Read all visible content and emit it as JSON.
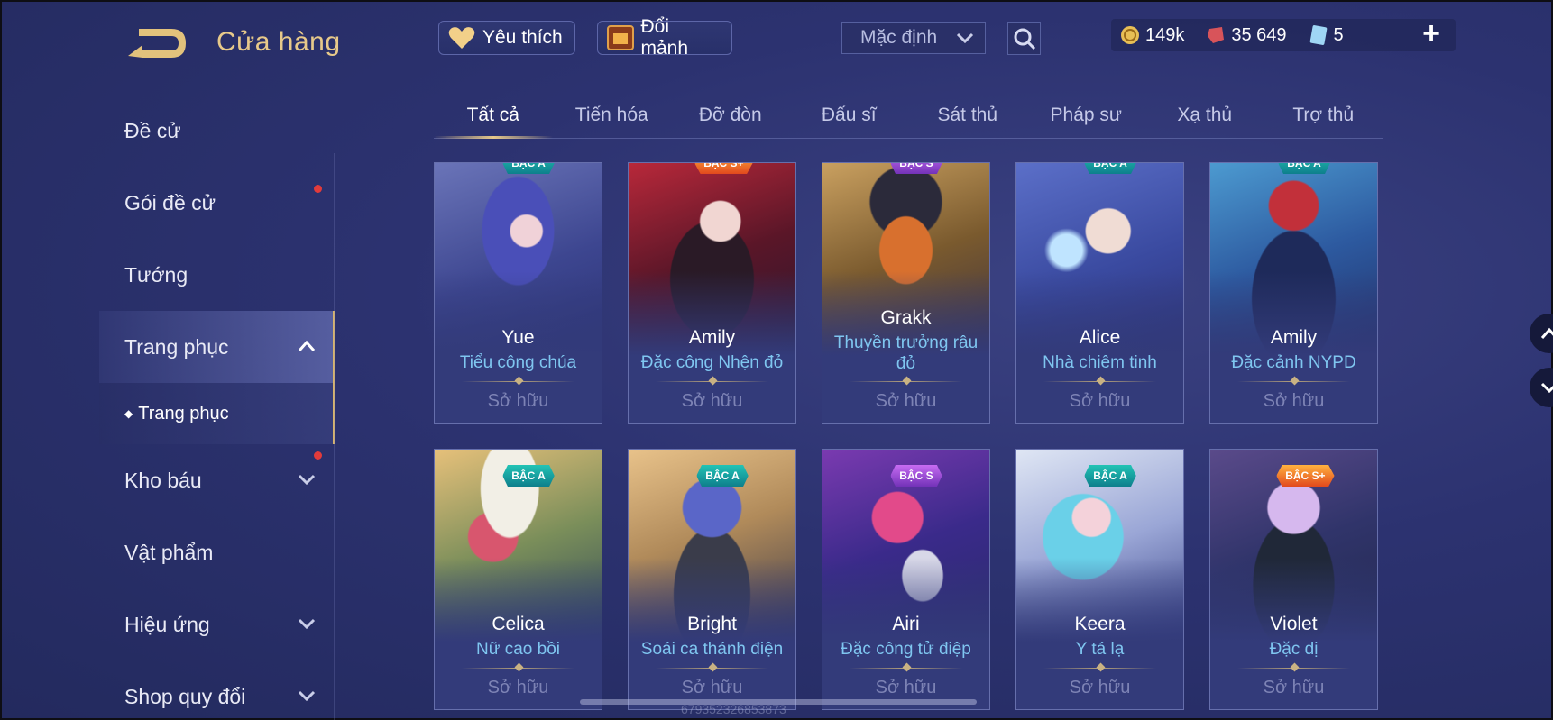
{
  "header": {
    "title": "Cửa hàng",
    "favorite_label": "Yêu thích",
    "shard_label": "Đổi mảnh",
    "sort_value": "Mặc định",
    "currencies": [
      {
        "icon": "gold-coin-icon",
        "value": "149k"
      },
      {
        "icon": "ruby-gem-icon",
        "value": "35 649"
      },
      {
        "icon": "voucher-card-icon",
        "value": "5"
      }
    ]
  },
  "sidebar": {
    "items": [
      {
        "label": "Đề cử"
      },
      {
        "label": "Gói đề cử",
        "badge": true
      },
      {
        "label": "Tướng"
      },
      {
        "label": "Trang phục",
        "expanded": true
      },
      {
        "label": "Kho báu",
        "badge": true
      },
      {
        "label": "Vật phẩm"
      },
      {
        "label": "Hiệu ứng"
      },
      {
        "label": "Shop quy đổi"
      }
    ],
    "sub_item": "Trang phục"
  },
  "tabs": [
    "Tất cả",
    "Tiến hóa",
    "Đỡ đòn",
    "Đấu sĩ",
    "Sát thủ",
    "Pháp sư",
    "Xạ thủ",
    "Trợ thủ"
  ],
  "active_tab": "Tất cả",
  "cards": [
    {
      "hero": "Yue",
      "skin": "Tiểu công chúa",
      "rank": "BẬC A",
      "status": "Sở hữu"
    },
    {
      "hero": "Amily",
      "skin": "Đặc công Nhện đỏ",
      "rank": "BẬC S+",
      "status": "Sở hữu"
    },
    {
      "hero": "Grakk",
      "skin": "Thuyền trưởng râu đỏ",
      "rank": "BẬC S",
      "status": "Sở hữu"
    },
    {
      "hero": "Alice",
      "skin": "Nhà chiêm tinh",
      "rank": "BẬC A",
      "status": "Sở hữu"
    },
    {
      "hero": "Amily",
      "skin": "Đặc cảnh NYPD",
      "rank": "BẬC A",
      "status": "Sở hữu"
    },
    {
      "hero": "Celica",
      "skin": "Nữ cao bồi",
      "rank": "BẬC A",
      "status": "Sở hữu"
    },
    {
      "hero": "Bright",
      "skin": "Soái ca thánh điện",
      "rank": "BẬC A",
      "status": "Sở hữu"
    },
    {
      "hero": "Airi",
      "skin": "Đặc công tử điệp",
      "rank": "BẬC S",
      "status": "Sở hữu"
    },
    {
      "hero": "Keera",
      "skin": "Y tá lạ",
      "rank": "BẬC A",
      "status": "Sở hữu"
    },
    {
      "hero": "Violet",
      "skin": "Đặc dị",
      "rank": "BẬC S+",
      "status": "Sở hữu"
    }
  ],
  "watermark": "679352326853873",
  "colors": {
    "accent_gold": "#e7c98a",
    "skin_name": "#7fc6f0",
    "badge_red": "#e23b3b"
  }
}
